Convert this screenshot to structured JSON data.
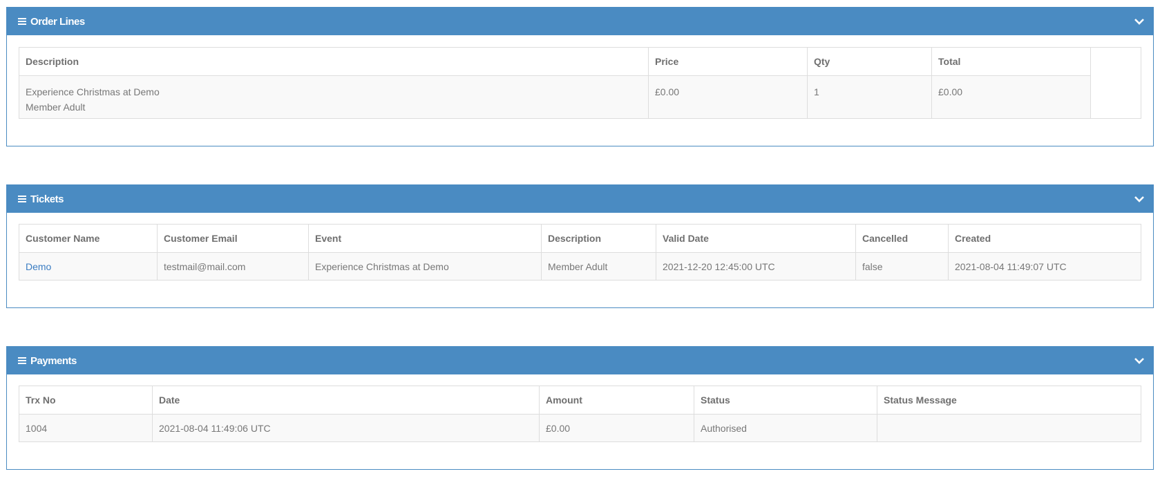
{
  "order_lines": {
    "title": "Order Lines",
    "headers": [
      "Description",
      "Price",
      "Qty",
      "Total"
    ],
    "row": {
      "description_line1": "Experience Christmas at Demo",
      "description_line2": "Member Adult",
      "price": "£0.00",
      "qty": "1",
      "total": "£0.00"
    }
  },
  "tickets": {
    "title": "Tickets",
    "headers": [
      "Customer Name",
      "Customer Email",
      "Event",
      "Description",
      "Valid Date",
      "Cancelled",
      "Created"
    ],
    "row": {
      "customer_name": "Demo",
      "customer_email": "testmail@mail.com",
      "event": "Experience Christmas at Demo",
      "description": "Member Adult",
      "valid_date": "2021-12-20 12:45:00 UTC",
      "cancelled": "false",
      "created": "2021-08-04 11:49:07 UTC"
    }
  },
  "payments": {
    "title": "Payments",
    "headers": [
      "Trx No",
      "Date",
      "Amount",
      "Status",
      "Status Message"
    ],
    "row": {
      "trx_no": "1004",
      "date": "2021-08-04 11:49:06 UTC",
      "amount": "£0.00",
      "status": "Authorised",
      "status_message": ""
    }
  },
  "colors": {
    "header_bg": "#4a8bc2",
    "link": "#3a7cc2"
  },
  "icons": [
    "bars-icon",
    "chevron-down-icon"
  ]
}
